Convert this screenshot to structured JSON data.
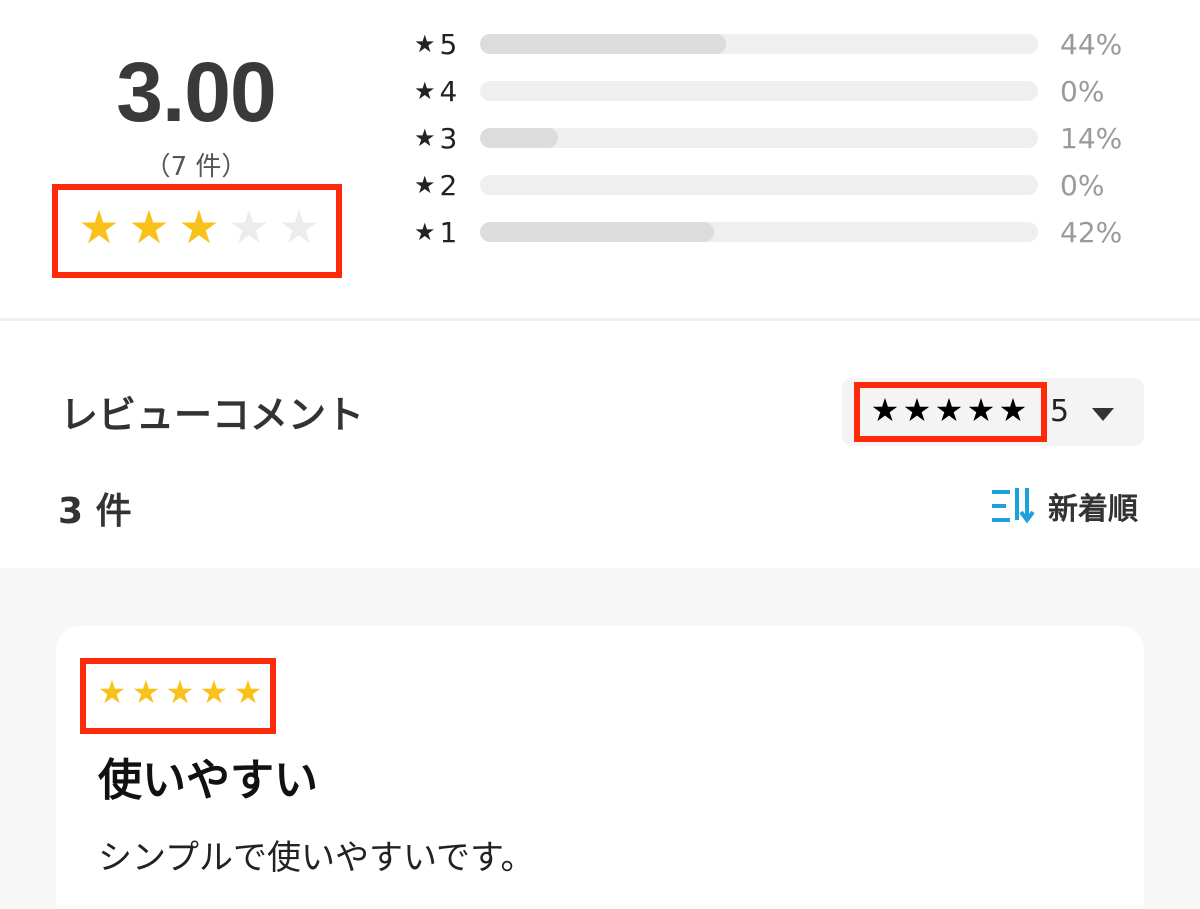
{
  "summary": {
    "average": "3.00",
    "count_label": "（7 件）",
    "stars_filled": 3,
    "stars_total": 5,
    "distribution": [
      {
        "label": "5",
        "percent_text": "44%",
        "fill": 0.44
      },
      {
        "label": "4",
        "percent_text": "0%",
        "fill": 0.0
      },
      {
        "label": "3",
        "percent_text": "14%",
        "fill": 0.14
      },
      {
        "label": "2",
        "percent_text": "0%",
        "fill": 0.0
      },
      {
        "label": "1",
        "percent_text": "42%",
        "fill": 0.42
      }
    ]
  },
  "reviews_header": {
    "title": "レビューコメント",
    "filter_value": "5",
    "filter_stars": 5,
    "count_label": "3 件",
    "sort_label": "新着順"
  },
  "reviews": [
    {
      "rating": 5,
      "title": "使いやすい",
      "body": "シンプルで使いやすいです。"
    }
  ],
  "colors": {
    "star_gold": "#f8c21a",
    "star_empty": "#ececec",
    "highlight": "#ff2a0a",
    "sort_icon": "#1ea0dc"
  },
  "icons": {
    "star": "star-icon",
    "caret": "chevron-down-icon",
    "sort": "sort-descending-icon"
  }
}
